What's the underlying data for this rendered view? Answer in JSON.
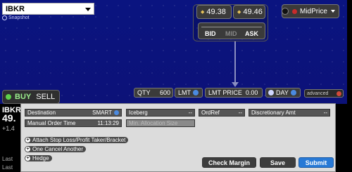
{
  "symbol": {
    "value": "IBKR",
    "sub_label": "Snapshot"
  },
  "quote": {
    "bid_price": "49.38",
    "ask_price": "49.46",
    "bid_label": "BID",
    "mid_label": "MID",
    "ask_label": "ASK"
  },
  "price_type": {
    "label": "MidPrice"
  },
  "side": {
    "buy_label": "BUY",
    "sell_label": "SELL"
  },
  "order": {
    "qty_label": "QTY",
    "qty_value": "600",
    "order_type": "LMT",
    "limit_label": "LMT PRICE",
    "limit_value": "0.00",
    "tif": "DAY",
    "advanced_label": "advanced"
  },
  "left_fragments": {
    "symbol": "IBKR",
    "price": "49.",
    "change": "+1.4",
    "last1": "Last",
    "last2": "Last"
  },
  "advanced_panel": {
    "destination_label": "Destination",
    "destination_value": "SMART",
    "iceberg_label": "Iceberg",
    "iceberg_value": "--",
    "ordref_label": "OrdRef",
    "ordref_value": "--",
    "discretionary_label": "Discretionary Amt",
    "discretionary_value": "--",
    "manual_time_label": "Manual Order Time",
    "manual_time_value": "11:13:29",
    "min_alloc_label": "Min. Allocation Size",
    "attach_label": "Attach Stop Loss/Profit Taker/Bracket",
    "oca_label": "One Cancel Another",
    "hedge_label": "Hedge",
    "check_margin_label": "Check Margin",
    "save_label": "Save",
    "submit_label": "Submit"
  },
  "colors": {
    "background": "#0c1278",
    "submit": "#2779d6",
    "buy": "#5dd04b"
  }
}
